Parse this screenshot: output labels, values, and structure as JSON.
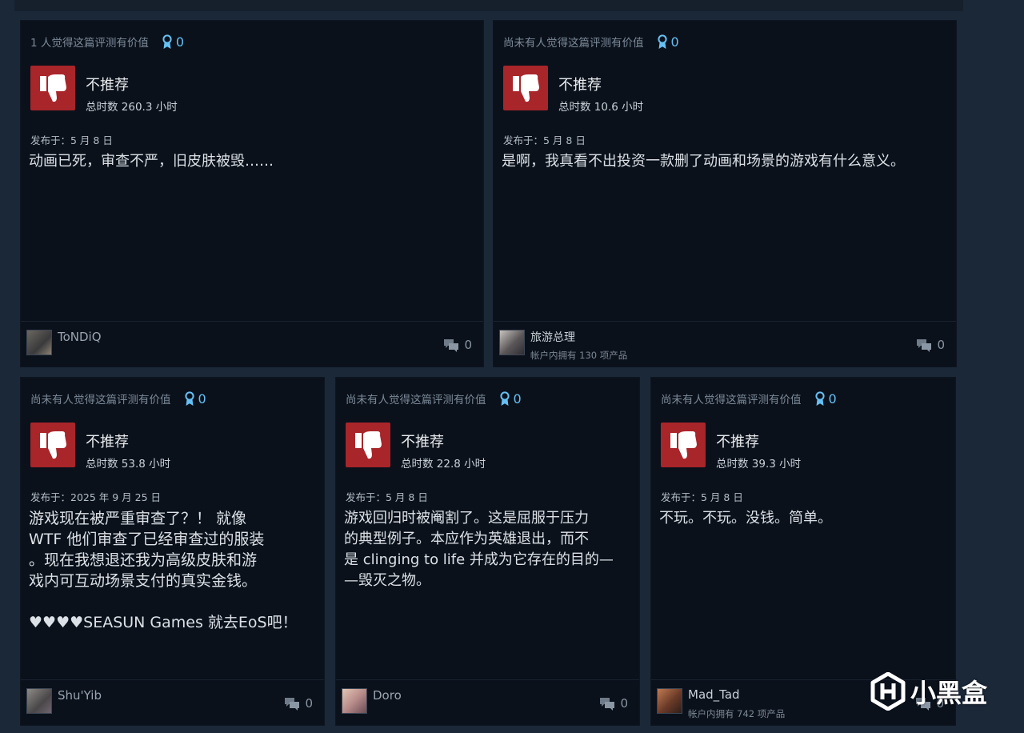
{
  "reviews": [
    {
      "helpful_text": "1 人觉得这篇评测有价值",
      "award_count": "0",
      "verdict": "不推荐",
      "hours": "总时数 260.3 小时",
      "posted": "发布于：5 月 8 日",
      "body": "动画已死，审查不严，旧皮肤被毁……",
      "author": "ToNDiQ",
      "products_owned": "",
      "comment_count": "0"
    },
    {
      "helpful_text": "尚未有人觉得这篇评测有价值",
      "award_count": "0",
      "verdict": "不推荐",
      "hours": "总时数 10.6 小时",
      "posted": "发布于：5 月 8 日",
      "body": "是啊，我真看不出投资一款删了动画和场景的游戏有什么意义。",
      "author": "旅游总理",
      "products_owned": "帐户内拥有 130 项产品",
      "comment_count": "0"
    },
    {
      "helpful_text": "尚未有人觉得这篇评测有价值",
      "award_count": "0",
      "verdict": "不推荐",
      "hours": "总时数 53.8 小时",
      "posted": "发布于：2025 年 9 月 25 日",
      "body": "游戏现在被严重审查了？！ 就像\nWTF 他们审查了已经审查过的服装\n。现在我想退还我为高级皮肤和游\n戏内可互动场景支付的真实金钱。\n\n♥♥♥♥SEASUN Games 就去EoS吧！",
      "author": "Shu'Yib",
      "products_owned": "",
      "comment_count": "0"
    },
    {
      "helpful_text": "尚未有人觉得这篇评测有价值",
      "award_count": "0",
      "verdict": "不推荐",
      "hours": "总时数 22.8 小时",
      "posted": "发布于：5 月 8 日",
      "body": "游戏回归时被阉割了。这是屈服于压力\n的典型例子。本应作为英雄退出，而不\n是 clinging to life 并成为它存在的目的—\n—毁灭之物。",
      "author": "Doro",
      "products_owned": "",
      "comment_count": "0"
    },
    {
      "helpful_text": "尚未有人觉得这篇评测有价值",
      "award_count": "0",
      "verdict": "不推荐",
      "hours": "总时数 39.3 小时",
      "posted": "发布于：5 月 8 日",
      "body": "不玩。不玩。没钱。简单。",
      "author": "Mad_Tad",
      "products_owned": "帐户内拥有 742 项产品",
      "comment_count": "0"
    }
  ],
  "watermark": {
    "text": "小黑盒"
  },
  "icons": {
    "thumb": "thumbs-down-icon",
    "award": "award-ribbon-icon",
    "comment": "comment-bubble-icon",
    "watermark": "heybox-logo-icon"
  },
  "colors": {
    "page_bg": "#1b2838",
    "card_bg": "#0b111b",
    "thumb_bg": "#a8252a",
    "award_blue": "#66c0f4"
  }
}
